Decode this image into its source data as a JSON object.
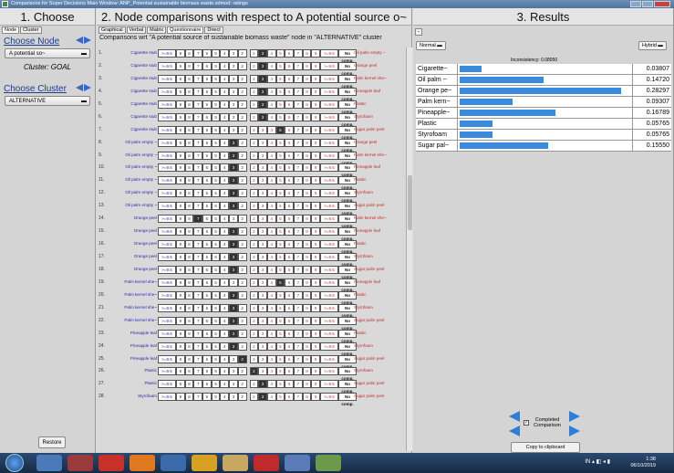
{
  "window": {
    "title": "Comparisons for Super Decisions Main Window: ANP_Potential sustainable biomass waste.sdmod: ratings"
  },
  "choose": {
    "header": "1. Choose",
    "tabs": [
      "Node",
      "Cluster"
    ],
    "choose_node_label": "Choose Node",
    "node_value": "A potential so~",
    "cluster_caption": "Cluster: GOAL",
    "choose_cluster_label": "Choose Cluster",
    "cluster_value": "ALTERNATIVE",
    "restore_label": "Restore"
  },
  "compare": {
    "header": "2. Node comparisons with respect to A potential source o~",
    "tabs": [
      "Graphical",
      "Verbal",
      "Matrix",
      "Questionnaire",
      "Direct"
    ],
    "caption": "Comparisons wrt \"A potential source of sustainable biomass waste\" node in \"ALTERNATIVE\" cluster",
    "scale_left": [
      ">=9.5",
      "9",
      "8",
      "7",
      "6",
      "5",
      "4",
      "3",
      "2"
    ],
    "scale_right": [
      "2",
      "3",
      "4",
      "5",
      "6",
      "7",
      "8",
      "9",
      ">=9.5"
    ],
    "no_comp_label": "No comp.",
    "rows": [
      {
        "n": "1.",
        "left": "Cigarette stub",
        "right": "Oil palm empty ~",
        "sel": "r3"
      },
      {
        "n": "2.",
        "left": "Cigarette stub",
        "right": "Orange peel",
        "sel": "r3"
      },
      {
        "n": "3.",
        "left": "Cigarette stub",
        "right": "Palm kernel she~",
        "sel": "r3"
      },
      {
        "n": "4.",
        "left": "Cigarette stub",
        "right": "Pineapple leaf",
        "sel": "r3"
      },
      {
        "n": "5.",
        "left": "Cigarette stub",
        "right": "Plastic",
        "sel": "r3"
      },
      {
        "n": "6.",
        "left": "Cigarette stub",
        "right": "Styrofoam",
        "sel": "r3"
      },
      {
        "n": "7.",
        "left": "Cigarette stub",
        "right": "Sugar palm peel",
        "sel": "r5"
      },
      {
        "n": "8.",
        "left": "Oil palm empty ~",
        "right": "Orange peel",
        "sel": "l3"
      },
      {
        "n": "9.",
        "left": "Oil palm empty ~",
        "right": "Palm kernel she~",
        "sel": "l3"
      },
      {
        "n": "10.",
        "left": "Oil palm empty ~",
        "right": "Pineapple leaf",
        "sel": "l3"
      },
      {
        "n": "11.",
        "left": "Oil palm empty ~",
        "right": "Plastic",
        "sel": "l3"
      },
      {
        "n": "12.",
        "left": "Oil palm empty ~",
        "right": "Styrofoam",
        "sel": "l3"
      },
      {
        "n": "13.",
        "left": "Oil palm empty ~",
        "right": "Sugar palm peel",
        "sel": "l3"
      },
      {
        "n": "14.",
        "left": "Orange peel",
        "right": "Palm kernel she~",
        "sel": "l7"
      },
      {
        "n": "15.",
        "left": "Orange peel",
        "right": "Pineapple leaf",
        "sel": "l3"
      },
      {
        "n": "16.",
        "left": "Orange peel",
        "right": "Plastic",
        "sel": "l3"
      },
      {
        "n": "17.",
        "left": "Orange peel",
        "right": "Styrofoam",
        "sel": "l3"
      },
      {
        "n": "18.",
        "left": "Orange peel",
        "right": "Sugar palm peel",
        "sel": "l3"
      },
      {
        "n": "19.",
        "left": "Palm kernel she~",
        "right": "Pineapple leaf",
        "sel": "r5"
      },
      {
        "n": "20.",
        "left": "Palm kernel she~",
        "right": "Plastic",
        "sel": "l3"
      },
      {
        "n": "21.",
        "left": "Palm kernel she~",
        "right": "Styrofoam",
        "sel": "l3"
      },
      {
        "n": "22.",
        "left": "Palm kernel she~",
        "right": "Sugar palm peel",
        "sel": "l3"
      },
      {
        "n": "23.",
        "left": "Pineapple leaf",
        "right": "Plastic",
        "sel": "l3"
      },
      {
        "n": "24.",
        "left": "Pineapple leaf",
        "right": "Styrofoam",
        "sel": "l3"
      },
      {
        "n": "25.",
        "left": "Pineapple leaf",
        "right": "Sugar palm peel",
        "sel": "l2"
      },
      {
        "n": "26.",
        "left": "Plastic",
        "right": "Styrofoam",
        "sel": "r2"
      },
      {
        "n": "27.",
        "left": "Plastic",
        "right": "Sugar palm peel",
        "sel": "r3"
      },
      {
        "n": "28.",
        "left": "Styrofoam",
        "right": "Sugar palm peel",
        "sel": "r3"
      }
    ]
  },
  "results": {
    "header": "3. Results",
    "mode_left": "Normal",
    "mode_right": "Hybrid",
    "inconsistency": "Inconsistency: 0.08950",
    "items": [
      {
        "name": "Cigarette~",
        "value": "0.03807",
        "share": 0.03807
      },
      {
        "name": "Oil palm ~",
        "value": "0.14720",
        "share": 0.1472
      },
      {
        "name": "Orange pe~",
        "value": "0.28297",
        "share": 0.28297
      },
      {
        "name": "Palm kern~",
        "value": "0.09307",
        "share": 0.09307
      },
      {
        "name": "Pineapple~",
        "value": "0.16789",
        "share": 0.16789
      },
      {
        "name": "Plastic",
        "value": "0.05765",
        "share": 0.05765
      },
      {
        "name": "Styrofoam",
        "value": "0.05765",
        "share": 0.05765
      },
      {
        "name": "Sugar pal~",
        "value": "0.15550",
        "share": 0.1555
      }
    ],
    "completed_label": "Completed Comparison",
    "copy_label": "Copy to clipboard"
  },
  "taskbar": {
    "time": "1:38",
    "date": "06/10/2019",
    "tray_text": "IN"
  }
}
